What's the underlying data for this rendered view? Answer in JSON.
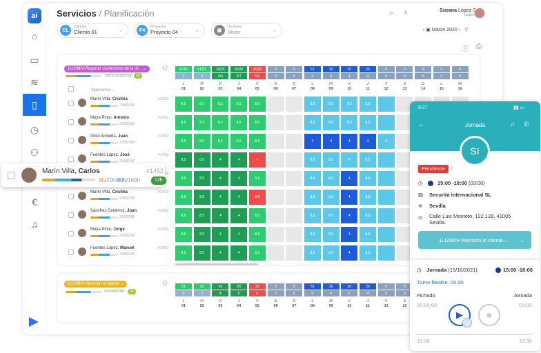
{
  "header": {
    "title": "Servicios",
    "subtitle": " / Planificación",
    "month": "Marzo 2020"
  },
  "filters": [
    {
      "chip": "CL",
      "color": "#4aa0e8",
      "label": "Clientes",
      "value": "Cliente 01"
    },
    {
      "chip": "P4",
      "color": "#4aa0e8",
      "label": "Proyectos",
      "value": "Proyecto 04"
    },
    {
      "chip": "",
      "color": "#888",
      "label": "Servicios",
      "value": "Mixto"
    }
  ],
  "user": {
    "first": "Susana",
    "last": " López Sanz",
    "role": "Supervisor"
  },
  "group1": {
    "tag": "1LI208/V-Reponer suministros de la of...",
    "hours": "150/120/300/500",
    "badge": "3h",
    "operators": "Operarios"
  },
  "group2": {
    "tag": "1LI208/V-Atención al cliente",
    "hours": "2/20/80/160",
    "badge": "3h"
  },
  "days": {
    "letters": [
      "L",
      "M",
      "X",
      "J",
      "V",
      "S",
      "D",
      "L",
      "M",
      "X",
      "J",
      "V",
      "S",
      "D",
      "L",
      "M"
    ],
    "numbers": [
      "01",
      "02",
      "03",
      "04",
      "05",
      "06",
      "07",
      "08",
      "09",
      "10",
      "11",
      "12",
      "13",
      "14",
      "15",
      "16"
    ]
  },
  "counters1": {
    "top": [
      "51/51",
      "51/51",
      "26/26",
      "26/26",
      "26/28",
      "0",
      "0",
      "51",
      "26",
      "26",
      "26",
      "0",
      "0",
      "0",
      "0",
      "0"
    ],
    "bottom": [
      "0",
      "0",
      "4/4",
      "5/7",
      "5/4",
      "0",
      "0",
      "0",
      "4",
      "4",
      "4",
      "0",
      "0",
      "0",
      "0",
      "0"
    ]
  },
  "counters2": {
    "top": [
      "51",
      "51",
      "26",
      "26",
      "28",
      "0",
      "0",
      "51",
      "26",
      "30",
      "26",
      "0",
      "0",
      "0",
      "0",
      "0"
    ],
    "bottom": [
      "0",
      "0",
      "4",
      "6",
      "6",
      "0",
      "0",
      "0",
      "4",
      "6",
      "4",
      "0",
      "0",
      "0",
      "0",
      "0"
    ]
  },
  "cell_value": "8,5",
  "cell_four": "4",
  "workers": [
    {
      "name": "Marín Villa, ",
      "bold": "Cristina",
      "id": "#1452",
      "hours": "20/80/160"
    },
    {
      "name": "Moya Pinto, ",
      "bold": "Antonio",
      "id": "#1452",
      "hours": "20/80/160"
    },
    {
      "name": "Pinto Almeida, ",
      "bold": "Juan",
      "id": "#1452",
      "hours": "20/80/160"
    },
    {
      "name": "Fuentes López, ",
      "bold": "José",
      "id": "#1452",
      "hours": "20/80/160"
    },
    {
      "name": "Marín Villa, ",
      "bold": "Carlos",
      "id": "#1452",
      "hours": "20/80/160"
    },
    {
      "name": "Marín Villa, ",
      "bold": "Cristina",
      "id": "#1452",
      "hours": "20/80/160"
    },
    {
      "name": "Sánchez Gutiérrez, ",
      "bold": "Juan",
      "id": "#1452",
      "hours": "20/80/160"
    },
    {
      "name": "Moya Pinto, ",
      "bold": "Jorge",
      "id": "#1452",
      "hours": "20/80/160"
    },
    {
      "name": "Fuentes López, ",
      "bold": "Manuel",
      "id": "#1452",
      "hours": "20/80/160"
    }
  ],
  "floating": {
    "name": "Marín Villa, ",
    "bold": "Carlos",
    "id": "#1452",
    "hours_a": "8h",
    "hours_b": "/20h/",
    "hours_c": "80h",
    "hours_d": "/160h",
    "badge": "12h"
  },
  "phone": {
    "time": "9:27",
    "title": "Jornada",
    "initials": "SI",
    "status": "Pendiente",
    "schedule": "15:00 -18:00",
    "duration": " (03:00)",
    "company": "Securita internacional SL",
    "city": "Sevilla",
    "address": "Calle Luis Montoto, 122,128, 41005 Sevilla.",
    "service": "1LI208/V-Atención al cliente...",
    "card_title": "Jornada",
    "card_date": " (15/10/2021)",
    "card_time": "15:00 -18:00",
    "flex": "Turno flexible: 00:30",
    "fichado": "Fichado",
    "jornada": "Jornada",
    "start": "00:00:00",
    "end": "03:00",
    "from": "15:00",
    "to": "18:30"
  },
  "colors": {
    "accent": "#1a73e8",
    "green": "#2ecc71",
    "darkgreen": "#1f9d55",
    "blue": "#1e5bd8",
    "navy": "#1a2f8a",
    "lightblue": "#5bc8e8",
    "red": "#ef4b4b",
    "grey": "#e8e8e8",
    "teal": "#2ab0ba"
  }
}
